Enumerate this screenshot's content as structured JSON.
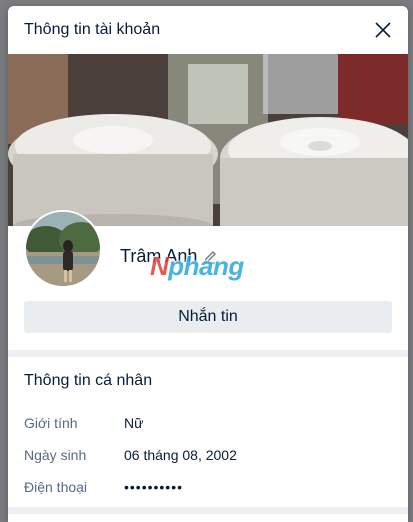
{
  "header": {
    "title": "Thông tin tài khoản"
  },
  "profile": {
    "name": "Trâm Anh",
    "watermark_prefix": "N",
    "watermark_rest": "phang",
    "message_button": "Nhắn tin"
  },
  "personal_info": {
    "title": "Thông tin cá nhân",
    "rows": [
      {
        "label": "Giới tính",
        "value": "Nữ"
      },
      {
        "label": "Ngày sinh",
        "value": "06 tháng 08, 2002"
      },
      {
        "label": "Điện thoại",
        "value": "••••••••••"
      }
    ]
  },
  "icons": {
    "close": "close-icon",
    "edit": "pencil-icon"
  }
}
